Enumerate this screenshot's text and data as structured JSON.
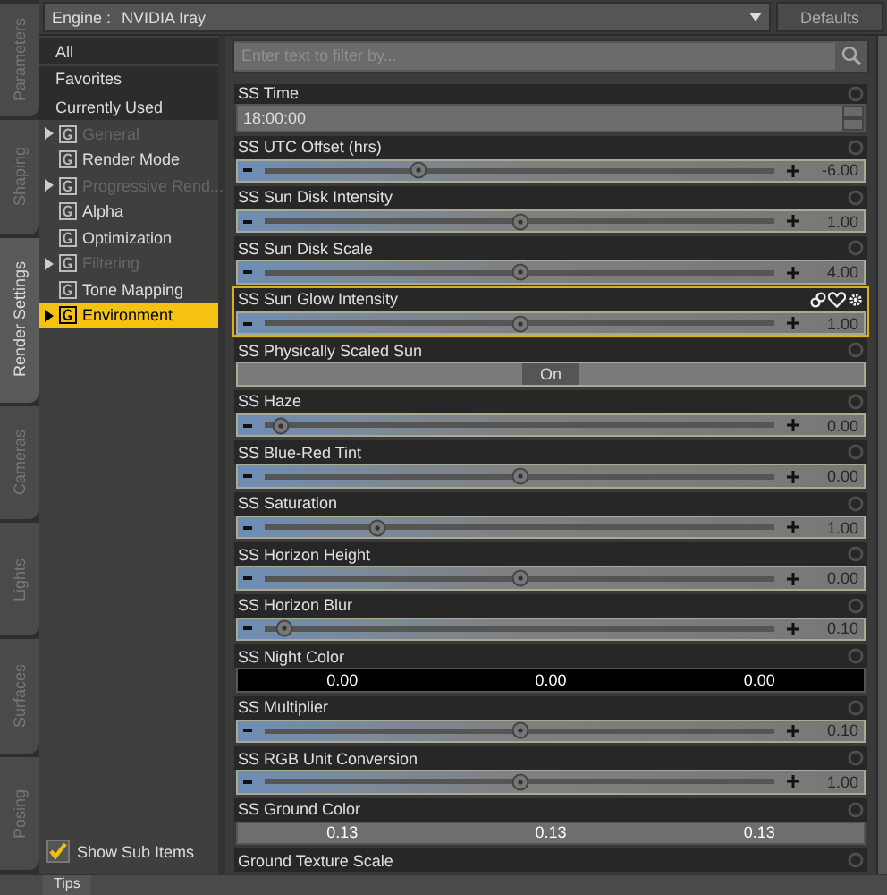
{
  "side_tabs": [
    {
      "label": "Parameters",
      "selected": false
    },
    {
      "label": "Shaping",
      "selected": false
    },
    {
      "label": "Render Settings",
      "selected": true
    },
    {
      "label": "Cameras",
      "selected": false
    },
    {
      "label": "Lights",
      "selected": false
    },
    {
      "label": "Surfaces",
      "selected": false
    },
    {
      "label": "Posing",
      "selected": false
    }
  ],
  "engine": {
    "label": "Engine :",
    "value": "NVIDIA Iray"
  },
  "defaults_button": "Defaults",
  "categories": [
    {
      "kind": "filter",
      "label": "All",
      "selected": false,
      "disabled": false
    },
    {
      "kind": "filter",
      "label": "Favorites",
      "selected": false,
      "disabled": false
    },
    {
      "kind": "filter",
      "label": "Currently Used",
      "selected": false,
      "disabled": false
    },
    {
      "kind": "group",
      "label": "General",
      "selected": false,
      "disabled": true,
      "expandable": true
    },
    {
      "kind": "group",
      "label": "Render Mode",
      "selected": false,
      "disabled": false,
      "expandable": false
    },
    {
      "kind": "group",
      "label": "Progressive Rend...",
      "selected": false,
      "disabled": true,
      "expandable": true
    },
    {
      "kind": "group",
      "label": "Alpha",
      "selected": false,
      "disabled": false,
      "expandable": false
    },
    {
      "kind": "group",
      "label": "Optimization",
      "selected": false,
      "disabled": false,
      "expandable": false
    },
    {
      "kind": "group",
      "label": "Filtering",
      "selected": false,
      "disabled": true,
      "expandable": true
    },
    {
      "kind": "group",
      "label": "Tone Mapping",
      "selected": false,
      "disabled": false,
      "expandable": false
    },
    {
      "kind": "group",
      "label": "Environment",
      "selected": true,
      "disabled": false,
      "expandable": true
    }
  ],
  "show_sub_items": {
    "label": "Show Sub Items",
    "checked": true
  },
  "filter": {
    "placeholder": "Enter text to filter by..."
  },
  "properties": [
    {
      "kind": "text",
      "name": "SS Time",
      "value": "18:00:00",
      "selected": false
    },
    {
      "kind": "slider",
      "name": "SS UTC Offset (hrs)",
      "level": 0.3,
      "reading": "-6.00",
      "selected": false
    },
    {
      "kind": "slider",
      "name": "SS Sun Disk Intensity",
      "level": 0.5,
      "reading": "1.00",
      "selected": false
    },
    {
      "kind": "slider",
      "name": "SS Sun Disk Scale",
      "level": 0.5,
      "reading": "4.00",
      "selected": false
    },
    {
      "kind": "slider",
      "name": "SS Sun Glow Intensity",
      "level": 0.5,
      "reading": "1.00",
      "selected": true
    },
    {
      "kind": "toggle",
      "name": "SS Physically Scaled Sun",
      "value": "On",
      "selected": false
    },
    {
      "kind": "slider",
      "name": "SS Haze",
      "level": 0.03,
      "reading": "0.00",
      "selected": false
    },
    {
      "kind": "slider",
      "name": "SS Blue-Red Tint",
      "level": 0.5,
      "reading": "0.00",
      "selected": false
    },
    {
      "kind": "slider",
      "name": "SS Saturation",
      "level": 0.22,
      "reading": "1.00",
      "selected": false
    },
    {
      "kind": "slider",
      "name": "SS Horizon Height",
      "level": 0.5,
      "reading": "0.00",
      "selected": false
    },
    {
      "kind": "slider",
      "name": "SS Horizon Blur",
      "level": 0.04,
      "reading": "0.10",
      "selected": false
    },
    {
      "kind": "color",
      "name": "SS Night Color",
      "color": "#000000",
      "values": [
        "0.00",
        "0.00",
        "0.00"
      ],
      "selected": false
    },
    {
      "kind": "slider",
      "name": "SS Multiplier",
      "level": 0.5,
      "reading": "0.10",
      "selected": false
    },
    {
      "kind": "slider",
      "name": "SS RGB Unit Conversion",
      "level": 0.5,
      "reading": "1.00",
      "selected": false
    },
    {
      "kind": "color",
      "name": "SS Ground Color",
      "color": "#6e6e6e",
      "values": [
        "0.13",
        "0.13",
        "0.13"
      ],
      "selected": false
    },
    {
      "kind": "label",
      "name": "Ground Texture Scale",
      "selected": false
    }
  ],
  "bottom_tabs": [
    {
      "label": "Tips",
      "selected": true
    }
  ]
}
